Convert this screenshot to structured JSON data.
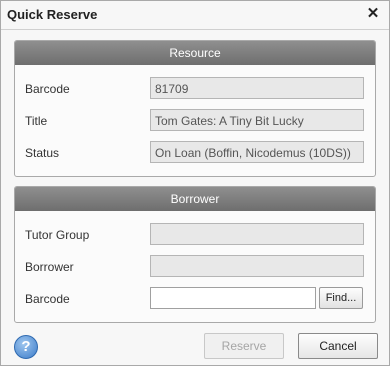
{
  "window": {
    "title": "Quick Reserve",
    "close_glyph": "✕"
  },
  "resource": {
    "header": "Resource",
    "barcode_label": "Barcode",
    "barcode_value": "81709",
    "title_label": "Title",
    "title_value": "Tom Gates: A Tiny Bit Lucky",
    "status_label": "Status",
    "status_value": "On Loan (Boffin, Nicodemus (10DS))"
  },
  "borrower": {
    "header": "Borrower",
    "tutor_group_label": "Tutor Group",
    "tutor_group_value": "",
    "borrower_label": "Borrower",
    "borrower_value": "",
    "barcode_label": "Barcode",
    "barcode_value": "",
    "find_label": "Find..."
  },
  "footer": {
    "help_icon": "help-icon",
    "help_glyph": "?",
    "reserve_label": "Reserve",
    "cancel_label": "Cancel"
  },
  "colors": {
    "panel_header": "#7d7d7d",
    "help_blue": "#3c7cc9",
    "disabled_text": "#a5a5a5"
  }
}
